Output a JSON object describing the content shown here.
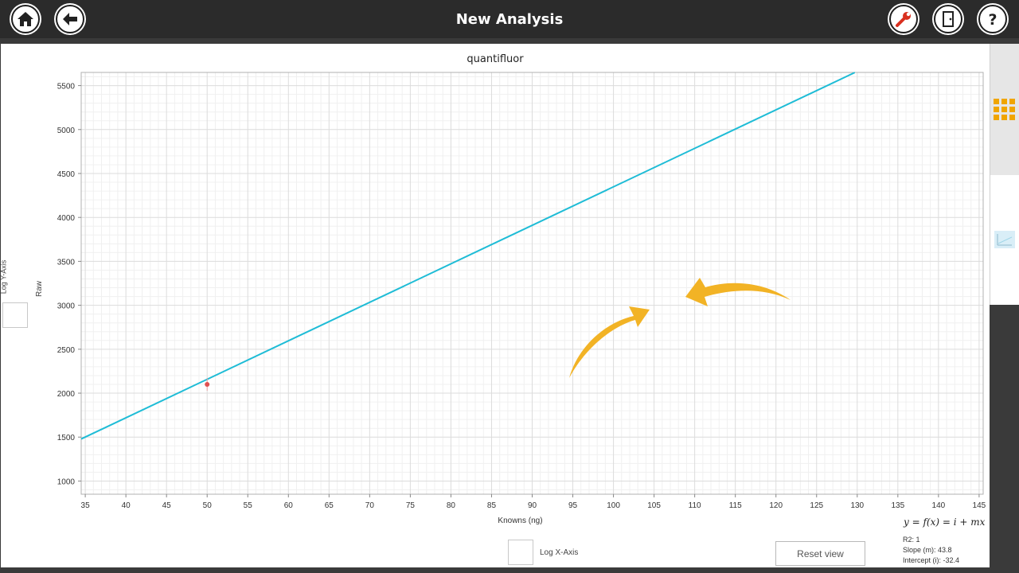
{
  "header": {
    "title": "New Analysis",
    "left_buttons": [
      "home-icon",
      "back-arrow-icon"
    ],
    "right_buttons": [
      "wrench-icon",
      "door-exit-icon",
      "help-icon"
    ]
  },
  "side_tabs": [
    "grid-icon",
    "chart-thumbnail-icon"
  ],
  "controls": {
    "log_y_label": "Log Y-Axis",
    "log_x_label": "Log X-Axis",
    "reset_label": "Reset view"
  },
  "fit": {
    "equation": "y = f(x) = i + mx",
    "r2": "R2: 1",
    "slope": "Slope (m): 43.8",
    "intercept": "Intercept (i): -32.4"
  },
  "colors": {
    "line": "#1ebcd6",
    "point": "#e05050",
    "arrow": "#f2b325",
    "accent": "#f0a500"
  },
  "chart_data": {
    "type": "scatter",
    "title": "quantifluor",
    "xlabel": "Knowns (ng)",
    "ylabel": "Raw",
    "xlim": [
      34.5,
      145.5
    ],
    "ylim": [
      850,
      5650
    ],
    "xticks": [
      35,
      40,
      45,
      50,
      55,
      60,
      65,
      70,
      75,
      80,
      85,
      90,
      95,
      100,
      105,
      110,
      115,
      120,
      125,
      130,
      135,
      140,
      145
    ],
    "yticks": [
      1000,
      1500,
      2000,
      2500,
      3000,
      3500,
      4000,
      4500,
      5000,
      5500
    ],
    "grid": true,
    "series": [
      {
        "type": "scatter",
        "x": [
          50
        ],
        "y": [
          2100
        ]
      },
      {
        "type": "line",
        "x": [
          34.5,
          129.7
        ],
        "y": [
          1478.7,
          5649
        ]
      }
    ]
  }
}
